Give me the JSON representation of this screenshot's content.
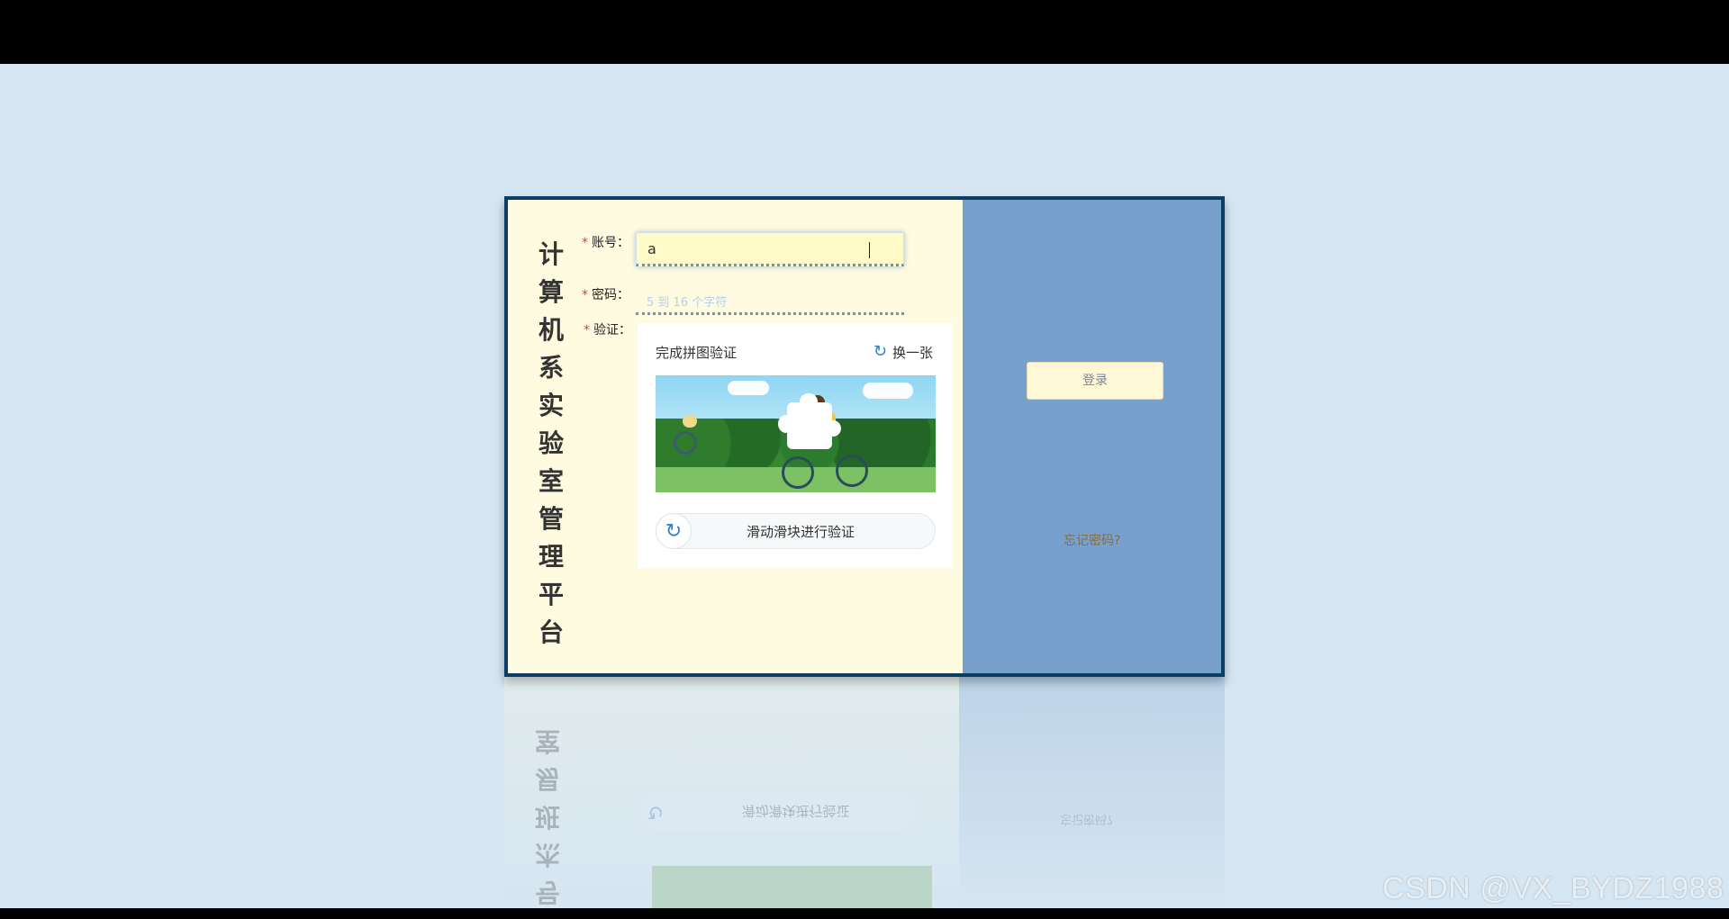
{
  "app": {
    "vertical_title_chars": [
      "计",
      "算",
      "机",
      "系",
      "实",
      "验",
      "室",
      "管",
      "理",
      "平",
      "台"
    ]
  },
  "form": {
    "account_label": "账号：",
    "account_value": "a",
    "password_label": "密码：",
    "password_placeholder": "5 到 16 个字符",
    "verify_label": "验证：",
    "required_mark": "*"
  },
  "captcha": {
    "title": "完成拼图验证",
    "refresh_label": "换一张",
    "slider_text": "滑动滑块进行验证",
    "refresh_icon": "refresh-icon"
  },
  "right_panel": {
    "login_label": "登录",
    "forgot_label": "忘记密码?"
  },
  "reflection": {
    "title_chars": [
      "号",
      "杰",
      "班",
      "易",
      "室"
    ],
    "slider_text": "滑动滑块进行验证",
    "forgot_label": "忘记密码?"
  },
  "watermark": "CSDN @VX_BYDZ1988",
  "colors": {
    "left_panel": "#fffbe0",
    "right_panel": "#77a0cd",
    "frame_border": "#0c3d64",
    "accent_blue": "#2e7fd1",
    "background": "#d6e6f2"
  }
}
